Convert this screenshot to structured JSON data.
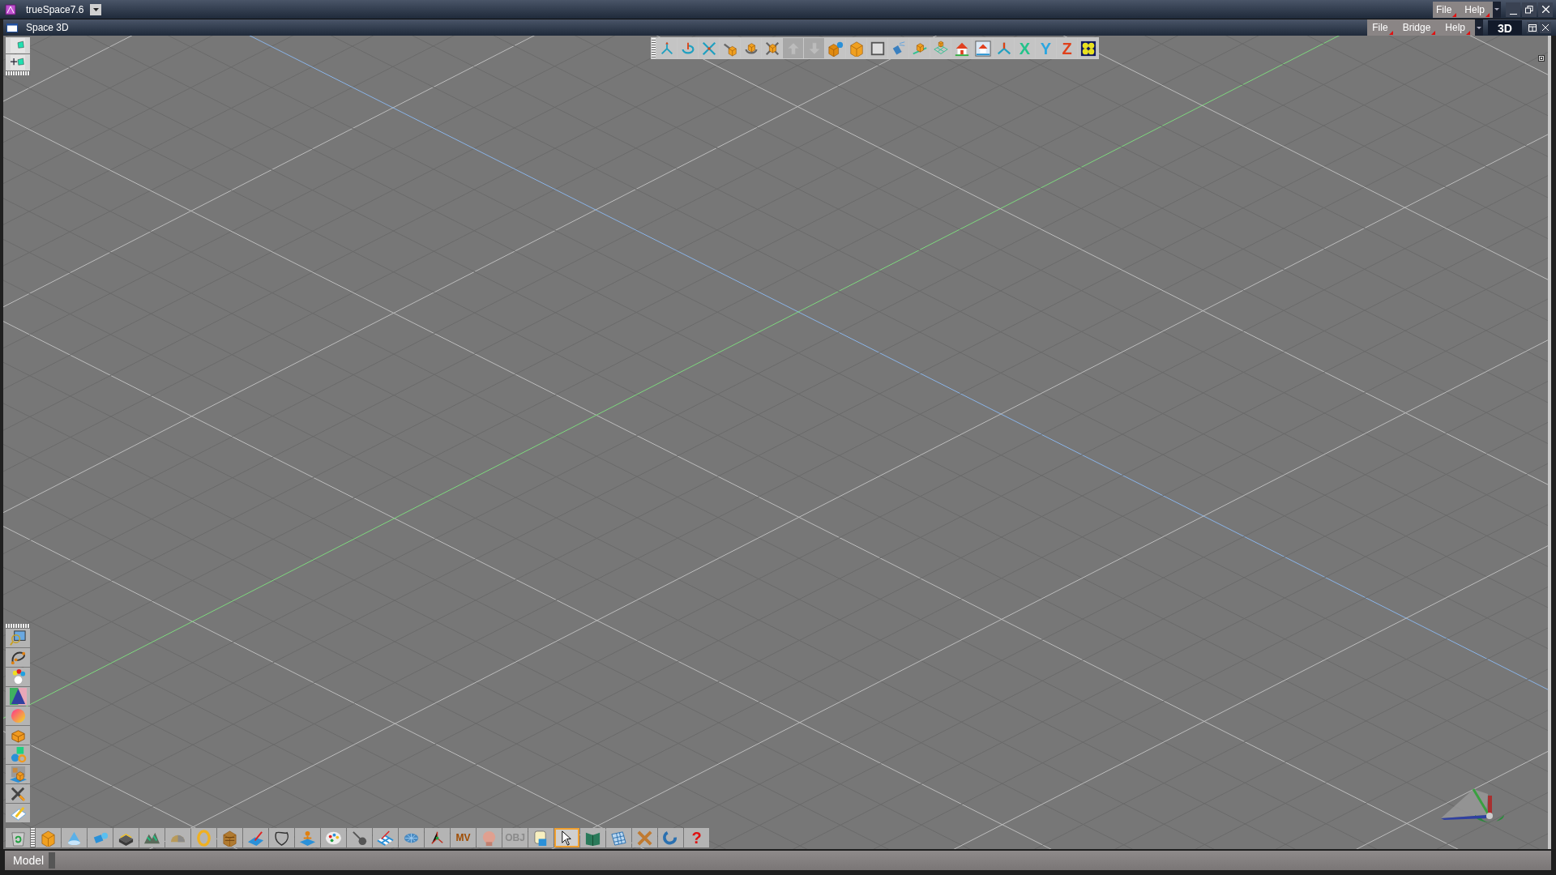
{
  "window": {
    "title": "trueSpace7.6",
    "menus": [
      "File",
      "Help"
    ]
  },
  "space_window": {
    "title": "Space 3D",
    "menus": [
      "File",
      "Bridge",
      "Help"
    ],
    "view_button": "3D"
  },
  "top_toolbar": [
    {
      "kind": "move",
      "disabled": false
    },
    {
      "kind": "rotate",
      "disabled": false
    },
    {
      "kind": "scale",
      "disabled": false
    },
    {
      "kind": "movebox",
      "disabled": false
    },
    {
      "kind": "rotatebox",
      "disabled": false
    },
    {
      "kind": "scalebox",
      "disabled": false
    },
    {
      "kind": "up",
      "disabled": true
    },
    {
      "kind": "down",
      "disabled": true
    },
    {
      "kind": "cubeball",
      "disabled": false
    },
    {
      "kind": "cube",
      "disabled": false
    },
    {
      "kind": "frame",
      "disabled": false
    },
    {
      "kind": "spray",
      "disabled": false
    },
    {
      "kind": "boxplane",
      "disabled": false
    },
    {
      "kind": "planegrid",
      "disabled": false
    },
    {
      "kind": "house",
      "disabled": false
    },
    {
      "kind": "houseframe",
      "disabled": false
    },
    {
      "kind": "axes",
      "disabled": false
    },
    {
      "kind": "letter",
      "text": "X",
      "color": "#22c38a",
      "disabled": false
    },
    {
      "kind": "letter",
      "text": "Y",
      "color": "#2ba6e0",
      "disabled": false
    },
    {
      "kind": "letter",
      "text": "Z",
      "color": "#e0401a",
      "disabled": false
    },
    {
      "kind": "flower",
      "disabled": false
    }
  ],
  "left_palette_top": [
    {
      "kind": "viewport"
    },
    {
      "kind": "addview"
    }
  ],
  "left_toolbar": [
    {
      "kind": "render"
    },
    {
      "kind": "path"
    },
    {
      "kind": "lights"
    },
    {
      "kind": "gradient"
    },
    {
      "kind": "sphere"
    },
    {
      "kind": "sofa"
    },
    {
      "kind": "shapes"
    },
    {
      "kind": "room"
    },
    {
      "kind": "tools"
    },
    {
      "kind": "notes"
    }
  ],
  "bottom_toolbar": [
    {
      "kind": "trash",
      "selected": false
    },
    {
      "kind": "cube",
      "selected": false
    },
    {
      "kind": "cone",
      "selected": false
    },
    {
      "kind": "spot",
      "selected": false
    },
    {
      "kind": "stack",
      "selected": false
    },
    {
      "kind": "trees",
      "selected": false
    },
    {
      "kind": "halfball",
      "selected": false
    },
    {
      "kind": "ring",
      "selected": false
    },
    {
      "kind": "bricks",
      "selected": false
    },
    {
      "kind": "paint",
      "selected": false
    },
    {
      "kind": "outline",
      "selected": false
    },
    {
      "kind": "figure",
      "selected": false
    },
    {
      "kind": "palette",
      "selected": false
    },
    {
      "kind": "brush",
      "selected": false
    },
    {
      "kind": "checker",
      "selected": false
    },
    {
      "kind": "mesh",
      "selected": false
    },
    {
      "kind": "bones",
      "selected": false
    },
    {
      "kind": "letter",
      "text": "MV",
      "color": "#a04c00",
      "selected": false
    },
    {
      "kind": "head",
      "selected": false
    },
    {
      "kind": "letter",
      "text": "OBJ",
      "color": "#8a8a8a",
      "selected": false
    },
    {
      "kind": "plug",
      "selected": false
    },
    {
      "kind": "pointer",
      "selected": true
    },
    {
      "kind": "book",
      "selected": false
    },
    {
      "kind": "grid",
      "selected": false
    },
    {
      "kind": "cross",
      "selected": false
    },
    {
      "kind": "hook",
      "selected": false
    },
    {
      "kind": "letter",
      "text": "?",
      "color": "#e01010",
      "selected": false
    }
  ],
  "status_bar": {
    "mode": "Model"
  }
}
